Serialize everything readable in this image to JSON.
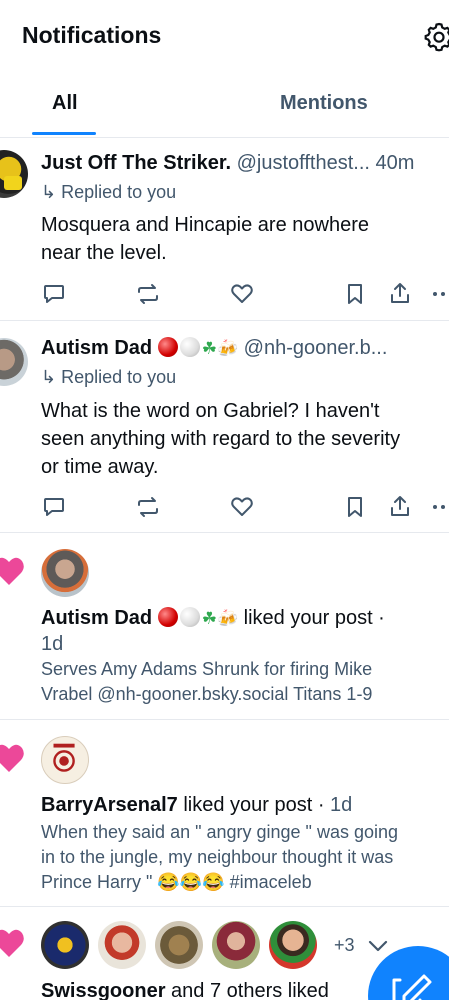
{
  "header": {
    "title": "Notifications",
    "settings_icon": "gear-icon"
  },
  "tabs": [
    {
      "label": "All",
      "active": true
    },
    {
      "label": "Mentions",
      "active": false
    }
  ],
  "colors": {
    "accent": "#1083fe",
    "like_heart": "#ec4899",
    "muted_text": "#42576c"
  },
  "notifications": [
    {
      "type": "reply",
      "author": "Just Off The Striker.",
      "handle": "@justoffthest...",
      "time": "40m",
      "replied": "Replied to you",
      "text_lines": [
        "Mosquera and Hincapie are nowhere",
        "near the level."
      ]
    },
    {
      "type": "reply",
      "author": "Autism Dad",
      "handle": "@nh-gooner.b...",
      "replied": "Replied to you",
      "text_lines": [
        "What is the word on Gabriel? I haven't",
        "seen anything with regard to the severity",
        "or time away."
      ]
    },
    {
      "type": "like",
      "author": "Autism Dad",
      "action": "liked your post ·",
      "time": "1d",
      "preview_lines": [
        "Serves Amy Adams Shrunk for firing Mike",
        "Vrabel @nh-gooner.bsky.social Titans 1-9"
      ]
    },
    {
      "type": "like",
      "author": "BarryArsenal7",
      "action": "liked your post ·",
      "time": "1d",
      "preview_lines": [
        "When they said an \" angry ginge \" was going",
        "in to the jungle, my neighbour thought it was",
        "Prince Harry \" 😂😂😂 #imaceleb"
      ]
    },
    {
      "type": "like-group",
      "author": "Swissgooner",
      "others": "and 7 others liked",
      "more_count": "+3"
    }
  ]
}
